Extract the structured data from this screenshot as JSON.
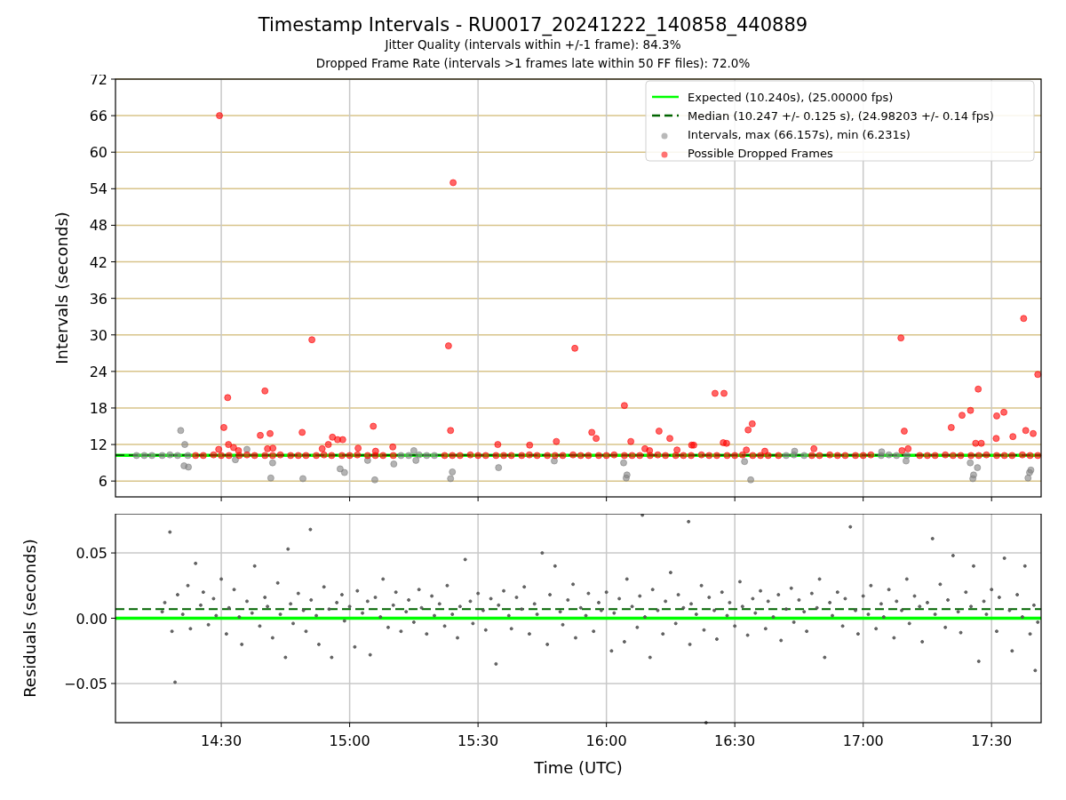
{
  "figure": {
    "title": "Timestamp Intervals - RU0017_20241222_140858_440889",
    "subtitle_lines": [
      "Jitter Quality (intervals within +/-1 frame): 84.3%",
      "Dropped Frame Rate (intervals >1 frames late within 50 FF files): 72.0%"
    ]
  },
  "intervals_panel": {
    "chart_data": {
      "type": "scatter",
      "grid": true,
      "legend": true,
      "ylabel": "Intervals (seconds)",
      "xlim": [
        14.088,
        17.693
      ],
      "ylim": [
        3.4,
        72
      ],
      "yticks": [
        {
          "value": 6,
          "label": "6"
        },
        {
          "value": 12,
          "label": "12"
        },
        {
          "value": 18,
          "label": "18"
        },
        {
          "value": 24,
          "label": "24"
        },
        {
          "value": 30,
          "label": "30"
        },
        {
          "value": 36,
          "label": "36"
        },
        {
          "value": 42,
          "label": "42"
        },
        {
          "value": 48,
          "label": "48"
        },
        {
          "value": 54,
          "label": "54"
        },
        {
          "value": 60,
          "label": "60"
        },
        {
          "value": 66,
          "label": "66"
        },
        {
          "value": 72,
          "label": "72"
        }
      ],
      "ref_lines": [
        {
          "axis": "y",
          "value": 10.24,
          "label": "Expected (10.240s), (25.00000 fps)",
          "color": "#00ff00"
        },
        {
          "axis": "y",
          "value": 10.247,
          "label": "Median (10.247 +/- 0.125 s), (24.98203 +/- 0.14 fps)",
          "color": "#006400"
        }
      ],
      "series": [
        {
          "name": "Intervals, max (66.157s), min (6.231s)",
          "color": "#808080",
          "x": [
            14.17,
            14.2,
            14.23,
            14.27,
            14.3,
            14.33,
            14.37,
            14.342,
            14.355,
            14.372,
            14.358,
            14.555,
            14.6,
            14.693,
            14.7,
            14.818,
            14.963,
            14.98,
            15.098,
            15.07,
            15.172,
            15.2,
            15.23,
            15.27,
            15.3,
            15.33,
            15.25,
            15.258,
            15.393,
            15.4,
            15.58,
            15.797,
            16.077,
            16.08,
            16.067,
            16.538,
            16.562,
            16.7,
            16.73,
            16.77,
            16.733,
            17.07,
            17.1,
            17.13,
            17.17,
            17.072,
            17.167,
            17.427,
            17.43,
            17.445,
            17.417,
            17.642,
            17.648,
            17.653
          ],
          "values": [
            10.2,
            10.2,
            10.2,
            10.2,
            10.3,
            10.2,
            10.2,
            14.3,
            8.5,
            8.3,
            12,
            9.5,
            11.2,
            6.5,
            9,
            6.4,
            8,
            7.4,
            6.2,
            9.4,
            8.8,
            10.2,
            10.2,
            10.3,
            10.2,
            10.2,
            11,
            9.4,
            6.4,
            7.5,
            8.2,
            9.3,
            6.5,
            7,
            9,
            9.2,
            6.2,
            10.2,
            10.3,
            10.2,
            10.9,
            10.2,
            10.3,
            10.2,
            10.2,
            10.8,
            9.3,
            6.4,
            7,
            8.2,
            9,
            6.5,
            7.4,
            7.8
          ]
        },
        {
          "name": "Possible Dropped Frames",
          "color": "#ff0000",
          "x": [
            14.4,
            14.43,
            14.47,
            14.5,
            14.53,
            14.57,
            14.6,
            14.63,
            14.67,
            14.7,
            14.73,
            14.77,
            14.8,
            14.83,
            14.87,
            14.9,
            14.93,
            14.97,
            15,
            15.03,
            15.07,
            15.1,
            15.13,
            15.17,
            15.37,
            15.4,
            15.43,
            15.47,
            15.5,
            15.53,
            15.57,
            15.6,
            15.63,
            15.67,
            15.7,
            15.73,
            15.77,
            15.8,
            15.83,
            15.87,
            15.9,
            15.93,
            15.97,
            16,
            16.03,
            16.07,
            16.1,
            16.13,
            16.17,
            16.2,
            16.23,
            16.27,
            16.3,
            16.33,
            16.37,
            16.4,
            16.43,
            16.47,
            16.5,
            16.53,
            16.57,
            16.6,
            16.63,
            16.67,
            16.8,
            16.83,
            16.87,
            16.9,
            16.93,
            16.97,
            17,
            17.03,
            17.22,
            17.25,
            17.28,
            17.32,
            17.35,
            17.38,
            17.42,
            17.45,
            17.48,
            17.52,
            17.55,
            17.58,
            17.62,
            17.65,
            17.68,
            14.493,
            14.525,
            14.51,
            14.528,
            14.548,
            14.49,
            14.567,
            14.67,
            14.652,
            14.69,
            14.68,
            14.701,
            14.853,
            14.815,
            14.893,
            14.917,
            14.933,
            14.953,
            14.973,
            15.033,
            15.092,
            15.101,
            15.168,
            15.403,
            15.385,
            15.393,
            15.577,
            15.701,
            15.805,
            15.877,
            15.943,
            15.96,
            16.07,
            16.095,
            16.15,
            16.168,
            16.205,
            16.247,
            16.275,
            16.332,
            16.34,
            16.423,
            16.458,
            16.455,
            16.468,
            16.552,
            16.568,
            16.545,
            16.617,
            16.808,
            17.147,
            17.16,
            17.151,
            17.175,
            17.343,
            17.385,
            17.418,
            17.448,
            17.438,
            17.46,
            17.52,
            17.548,
            17.518,
            17.583,
            17.625,
            17.633,
            17.662,
            17.68
          ],
          "values": [
            10.2,
            10.2,
            10.3,
            10.2,
            10.2,
            10.2,
            10.3,
            10.2,
            10.2,
            10.2,
            10.3,
            10.2,
            10.2,
            10.2,
            10.2,
            10.3,
            10.2,
            10.2,
            10.2,
            10.3,
            10.2,
            10.2,
            10.2,
            10.2,
            10.2,
            10.2,
            10.2,
            10.3,
            10.2,
            10.2,
            10.2,
            10.2,
            10.2,
            10.2,
            10.3,
            10.2,
            10.2,
            10.2,
            10.2,
            10.3,
            10.2,
            10.2,
            10.2,
            10.2,
            10.3,
            10.2,
            10.2,
            10.2,
            10.2,
            10.3,
            10.2,
            10.2,
            10.2,
            10.2,
            10.3,
            10.2,
            10.2,
            10.2,
            10.2,
            10.3,
            10.2,
            10.2,
            10.2,
            10.2,
            10.2,
            10.2,
            10.3,
            10.2,
            10.2,
            10.2,
            10.2,
            10.3,
            10.2,
            10.2,
            10.2,
            10.3,
            10.2,
            10.2,
            10.2,
            10.2,
            10.3,
            10.2,
            10.2,
            10.2,
            10.3,
            10.2,
            10.2,
            66,
            19.7,
            14.8,
            12,
            11.5,
            11.2,
            11,
            20.8,
            13.5,
            13.8,
            11.3,
            11.4,
            29.2,
            14,
            11.3,
            12,
            13.2,
            12.8,
            12.8,
            11.4,
            15,
            10.9,
            11.6,
            55,
            28.2,
            14.3,
            12,
            11.9,
            12.5,
            27.8,
            14,
            13,
            18.4,
            12.5,
            11.3,
            11,
            14.2,
            13,
            11.1,
            11.9,
            11.9,
            20.4,
            20.4,
            12.3,
            12.2,
            14.4,
            15.4,
            11.1,
            10.9,
            11.3,
            29.5,
            14.2,
            11,
            11.3,
            14.8,
            16.8,
            17.6,
            21.1,
            12.2,
            12.2,
            16.7,
            17.3,
            13,
            13.3,
            32.7,
            14.3,
            13.8,
            23.5
          ]
        }
      ]
    }
  },
  "residuals_panel": {
    "chart_data": {
      "type": "scatter",
      "grid": true,
      "xlabel": "Time (UTC)",
      "ylabel": "Residuals (seconds)",
      "xlim": [
        14.088,
        17.693
      ],
      "ylim": [
        -0.08,
        0.08
      ],
      "xticks": [
        {
          "value": 14.5,
          "label": "14:30"
        },
        {
          "value": 15,
          "label": "15:00"
        },
        {
          "value": 15.5,
          "label": "15:30"
        },
        {
          "value": 16,
          "label": "16:00"
        },
        {
          "value": 16.5,
          "label": "16:30"
        },
        {
          "value": 17,
          "label": "17:00"
        },
        {
          "value": 17.5,
          "label": "17:30"
        }
      ],
      "yticks": [
        {
          "value": -0.05,
          "label": "−0.05"
        },
        {
          "value": 0,
          "label": "0.00"
        },
        {
          "value": 0.05,
          "label": "0.05"
        }
      ],
      "ref_lines": [
        {
          "axis": "y",
          "value": 0,
          "color": "#00ff00"
        },
        {
          "axis": "y",
          "value": 0.007,
          "color": "#006400"
        }
      ],
      "series": [
        {
          "color": "#555555",
          "x": [
            14.27,
            14.28,
            14.3,
            14.308,
            14.32,
            14.33,
            14.35,
            14.37,
            14.38,
            14.4,
            14.42,
            14.43,
            14.45,
            14.47,
            14.48,
            14.5,
            14.52,
            14.53,
            14.55,
            14.57,
            14.58,
            14.6,
            14.62,
            14.63,
            14.65,
            14.67,
            14.68,
            14.7,
            14.72,
            14.73,
            14.75,
            14.76,
            14.77,
            14.78,
            14.8,
            14.82,
            14.83,
            14.847,
            14.85,
            14.87,
            14.88,
            14.9,
            14.92,
            14.93,
            14.95,
            14.97,
            14.98,
            15,
            15.02,
            15.03,
            15.05,
            15.07,
            15.08,
            15.1,
            15.12,
            15.13,
            15.15,
            15.17,
            15.18,
            15.2,
            15.22,
            15.23,
            15.25,
            15.27,
            15.28,
            15.3,
            15.32,
            15.33,
            15.35,
            15.37,
            15.38,
            15.4,
            15.42,
            15.43,
            15.45,
            15.47,
            15.48,
            15.5,
            15.52,
            15.53,
            15.55,
            15.57,
            15.58,
            15.6,
            15.62,
            15.63,
            15.65,
            15.67,
            15.68,
            15.7,
            15.72,
            15.73,
            15.75,
            15.77,
            15.78,
            15.8,
            15.82,
            15.83,
            15.85,
            15.87,
            15.88,
            15.9,
            15.92,
            15.93,
            15.95,
            15.97,
            15.98,
            16,
            16.02,
            16.03,
            16.05,
            16.07,
            16.08,
            16.1,
            16.12,
            16.13,
            16.14,
            16.15,
            16.17,
            16.18,
            16.2,
            16.22,
            16.23,
            16.25,
            16.27,
            16.28,
            16.3,
            16.32,
            16.325,
            16.33,
            16.35,
            16.37,
            16.38,
            16.388,
            16.4,
            16.42,
            16.43,
            16.45,
            16.47,
            16.48,
            16.5,
            16.52,
            16.53,
            16.55,
            16.57,
            16.58,
            16.6,
            16.62,
            16.63,
            16.65,
            16.67,
            16.68,
            16.7,
            16.72,
            16.73,
            16.75,
            16.77,
            16.78,
            16.8,
            16.82,
            16.83,
            16.85,
            16.87,
            16.88,
            16.9,
            16.92,
            16.93,
            16.95,
            16.97,
            16.98,
            17,
            17.02,
            17.03,
            17.05,
            17.07,
            17.08,
            17.1,
            17.12,
            17.13,
            17.15,
            17.17,
            17.18,
            17.2,
            17.22,
            17.23,
            17.25,
            17.27,
            17.28,
            17.3,
            17.32,
            17.33,
            17.35,
            17.37,
            17.38,
            17.4,
            17.42,
            17.43,
            17.45,
            17.47,
            17.48,
            17.5,
            17.52,
            17.53,
            17.55,
            17.57,
            17.58,
            17.6,
            17.62,
            17.63,
            17.65,
            17.665,
            17.67,
            17.68
          ],
          "values": [
            0.005,
            0.012,
            0.066,
            -0.01,
            -0.049,
            0.018,
            0.003,
            0.025,
            -0.008,
            0.042,
            0.01,
            0.02,
            -0.005,
            0.015,
            0.002,
            0.03,
            -0.012,
            0.008,
            0.022,
            0.001,
            -0.02,
            0.013,
            0.004,
            0.04,
            -0.006,
            0.016,
            0.009,
            -0.015,
            0.027,
            0.003,
            -0.03,
            0.053,
            0.011,
            -0.004,
            0.019,
            0.006,
            -0.01,
            0.068,
            0.014,
            0.002,
            -0.02,
            0.024,
            0.007,
            -0.03,
            0.012,
            0.018,
            -0.002,
            0.009,
            -0.022,
            0.021,
            0.004,
            0.013,
            -0.028,
            0.016,
            0.001,
            0.03,
            -0.007,
            0.01,
            0.02,
            -0.01,
            0.005,
            0.014,
            -0.003,
            0.022,
            0.008,
            -0.012,
            0.017,
            0.002,
            0.011,
            -0.006,
            0.025,
            0.003,
            -0.015,
            0.009,
            0.045,
            0.013,
            -0.004,
            0.019,
            0.006,
            -0.009,
            0.015,
            -0.035,
            0.01,
            0.021,
            0.002,
            -0.008,
            0.016,
            0.007,
            0.024,
            -0.012,
            0.011,
            0.003,
            0.05,
            -0.02,
            0.018,
            0.04,
            0.005,
            -0.005,
            0.014,
            0.026,
            -0.015,
            0.008,
            0.002,
            0.019,
            -0.01,
            0.012,
            0.006,
            0.02,
            -0.025,
            0.004,
            0.015,
            -0.018,
            0.03,
            0.009,
            -0.007,
            0.017,
            0.079,
            0.001,
            -0.03,
            0.022,
            0.006,
            -0.012,
            0.013,
            0.035,
            -0.004,
            0.018,
            0.008,
            0.074,
            -0.02,
            0.011,
            0.003,
            0.025,
            -0.009,
            -0.08,
            0.016,
            0.006,
            -0.016,
            0.02,
            0.002,
            0.012,
            -0.006,
            0.028,
            0.009,
            -0.013,
            0.015,
            0.004,
            0.021,
            -0.008,
            0.013,
            0.001,
            0.018,
            -0.017,
            0.007,
            0.023,
            -0.003,
            0.014,
            0.005,
            -0.01,
            0.019,
            0.008,
            0.03,
            -0.03,
            0.012,
            0.002,
            0.02,
            -0.006,
            0.015,
            0.07,
            0.006,
            -0.012,
            0.017,
            0.003,
            0.025,
            -0.008,
            0.011,
            0.001,
            0.022,
            -0.015,
            0.013,
            0.006,
            0.03,
            -0.004,
            0.017,
            0.009,
            -0.018,
            0.012,
            0.061,
            0.003,
            0.026,
            -0.007,
            0.014,
            0.048,
            0.005,
            -0.011,
            0.02,
            0.009,
            0.04,
            -0.033,
            0.013,
            0.003,
            0.022,
            -0.01,
            0.016,
            0.046,
            0.006,
            -0.025,
            0.018,
            0.001,
            0.04,
            -0.012,
            0.01,
            -0.04,
            -0.003
          ]
        }
      ]
    }
  }
}
